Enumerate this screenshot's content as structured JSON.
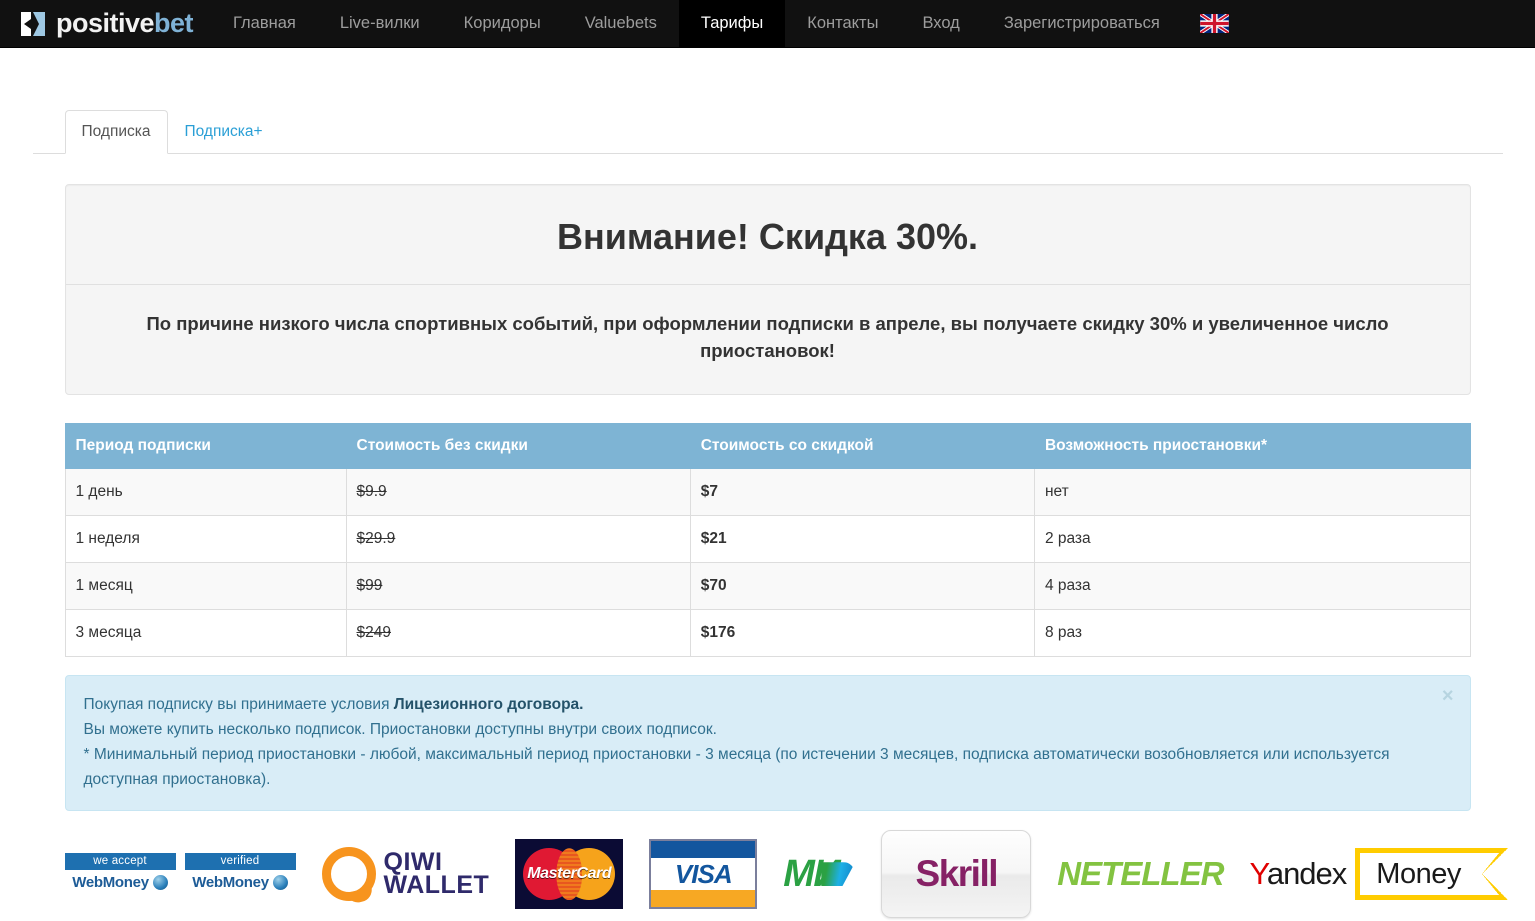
{
  "brand": {
    "logo_icon": "positivebet-k-mark-icon",
    "text_white": "positive",
    "text_blue": "bet"
  },
  "nav": {
    "items": [
      {
        "label": "Главная",
        "active": false
      },
      {
        "label": "Live-вилки",
        "active": false
      },
      {
        "label": "Коридоры",
        "active": false
      },
      {
        "label": "Valuebets",
        "active": false
      },
      {
        "label": "Тарифы",
        "active": true
      },
      {
        "label": "Контакты",
        "active": false
      },
      {
        "label": "Вход",
        "active": false
      },
      {
        "label": "Зарегистрироваться",
        "active": false
      }
    ],
    "language_flag": "uk-flag-icon"
  },
  "tabs": [
    {
      "label": "Подписка",
      "active": true
    },
    {
      "label": "Подписка+",
      "active": false
    }
  ],
  "promo": {
    "heading": "Внимание! Скидка 30%.",
    "body": "По причине низкого числа спортивных событий, при оформлении подписки в апреле, вы получаете скидку 30% и увеличенное число приостановок!"
  },
  "table": {
    "headers": [
      "Период подписки",
      "Стоимость без скидки",
      "Стоимость со скидкой",
      "Возможность приостановки*"
    ],
    "rows": [
      {
        "period": "1 день",
        "full_price": "$9.9",
        "discount_price": "$7",
        "pauses": "нет"
      },
      {
        "period": "1 неделя",
        "full_price": "$29.9",
        "discount_price": "$21",
        "pauses": "2 раза"
      },
      {
        "period": "1 месяц",
        "full_price": "$99",
        "discount_price": "$70",
        "pauses": "4 раза"
      },
      {
        "period": "3 месяца",
        "full_price": "$249",
        "discount_price": "$176",
        "pauses": "8 раз"
      }
    ]
  },
  "alert": {
    "line1_prefix": "Покупая подписку вы принимаете условия ",
    "line1_link": "Лицезионного договора.",
    "line2": "Вы можете купить несколько подписок. Приостановки доступны внутри своих подписок.",
    "line3": "* Минимальный период приостановки - любой, максимальный период приостановки - 3 месяца (по истечении 3 месяцев, подписка автоматически возобновляется или используется доступная приостановка).",
    "close_label": "×"
  },
  "payments": {
    "webmoney_accept_top": "we accept",
    "webmoney_accept_bottom": "WebMoney",
    "webmoney_verified_top": "verified",
    "webmoney_verified_bottom": "WebMoney",
    "qiwi_line1": "QIWI",
    "qiwi_line2": "WALLET",
    "mastercard": "MasterCard",
    "visa": "VISA",
    "mir": "МИ",
    "skrill": "Skrill",
    "neteller": "NETELLER",
    "yandex_y": "Y",
    "yandex_rest": "andex",
    "yandex_money": "Money"
  },
  "colors": {
    "navbar_bg": "#111111",
    "brand_blue": "#7fb2d6",
    "tab_link": "#2a9fd6",
    "table_header_bg": "#7eb4d4",
    "alert_bg": "#d9edf7",
    "alert_text": "#31708f"
  }
}
